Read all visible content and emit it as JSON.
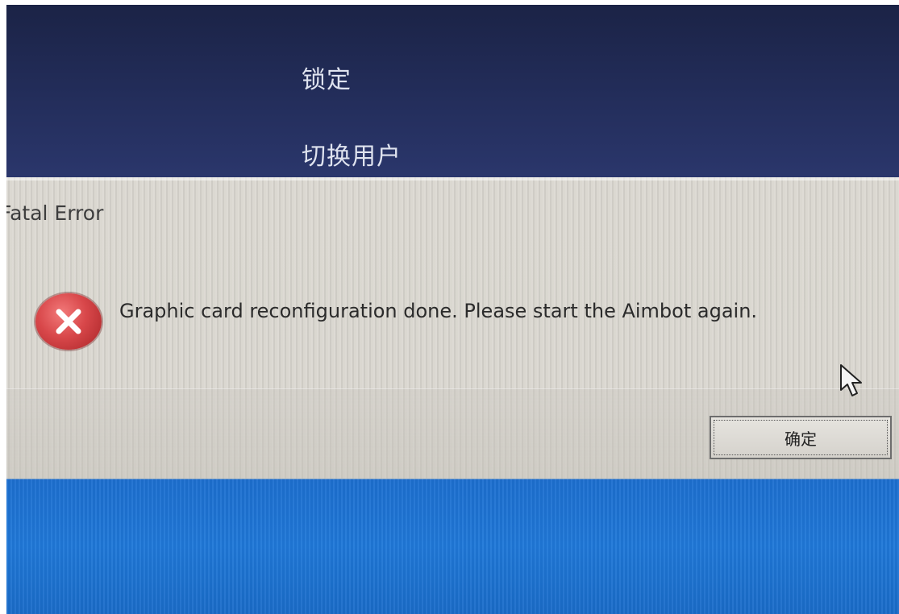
{
  "background_menu": {
    "lock_label": "锁定",
    "switch_user_label": "切换用户"
  },
  "dialog": {
    "title": "Fatal Error",
    "message": "Graphic card reconfiguration done. Please start the Aimbot again.",
    "icon": "error-icon",
    "ok_label": "确定"
  },
  "colors": {
    "top_background": "#222c58",
    "dialog_background": "#d9d6cf",
    "bottom_background": "#1f78d8",
    "error_icon": "#d8474a"
  }
}
